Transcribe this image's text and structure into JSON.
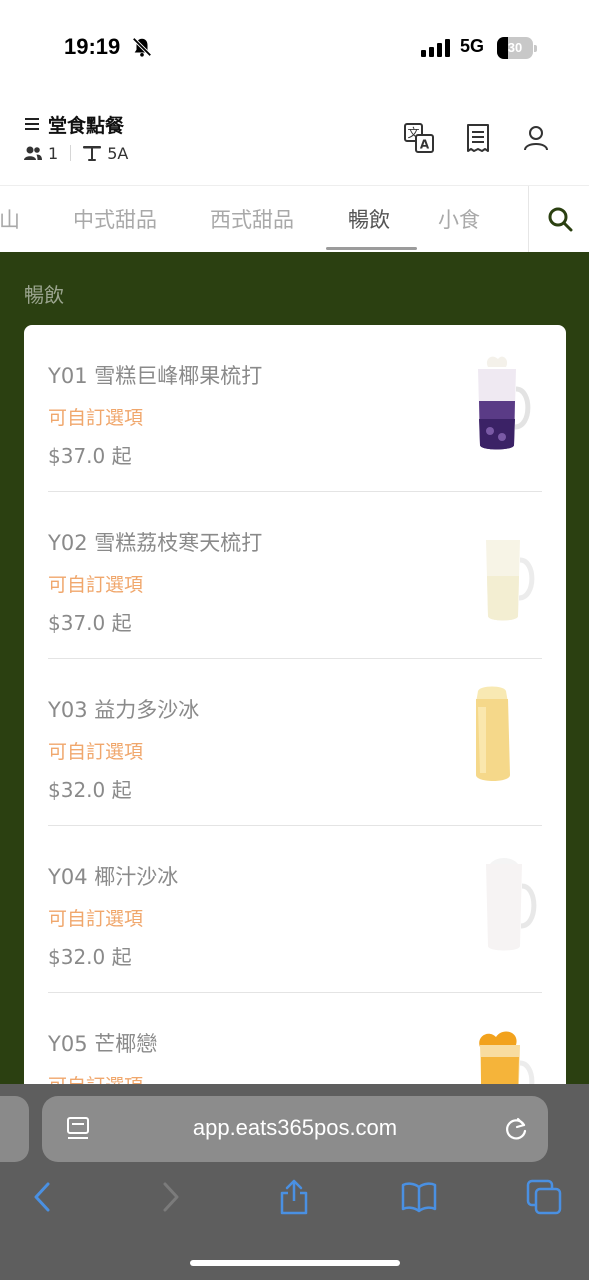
{
  "status_bar": {
    "time": "19:19",
    "network": "5G",
    "battery_percent": "30",
    "battery_level": 0.3
  },
  "header": {
    "title": "堂食點餐",
    "guest_count": "1",
    "table_number": "5A",
    "icons": [
      "menu-icon",
      "people-icon",
      "table-icon",
      "translate-icon",
      "receipt-icon",
      "user-icon"
    ]
  },
  "tabs": {
    "items": [
      "雪山",
      "中式甜品",
      "西式甜品",
      "暢飲",
      "小食"
    ],
    "active": "暢飲"
  },
  "section": {
    "title": "暢飲"
  },
  "menu_items": [
    {
      "name": "Y01 雪糕巨峰椰果梳打",
      "option_label": "可自訂選項",
      "price": "$37.0 起",
      "image": "purple-soda-glass"
    },
    {
      "name": "Y02 雪糕荔枝寒天梳打",
      "option_label": "可自訂選項",
      "price": "$37.0 起",
      "image": "lychee-soda-mug"
    },
    {
      "name": "Y03 益力多沙冰",
      "option_label": "可自訂選項",
      "price": "$32.0 起",
      "image": "yakult-slush-cup"
    },
    {
      "name": "Y04 椰汁沙冰",
      "option_label": "可自訂選項",
      "price": "$32.0 起",
      "image": "coconut-slush-mug"
    },
    {
      "name": "Y05 芒椰戀",
      "option_label": "可自訂選項",
      "price": "",
      "image": "mango-coconut-mug"
    }
  ],
  "browser": {
    "url": "app.eats365pos.com"
  },
  "colors": {
    "content_bg": "#2b4011",
    "option_text": "#f0a76c",
    "item_text": "#8a8a8a",
    "browser_bar": "#5e5e5e",
    "browser_accent": "#4a90e2"
  }
}
